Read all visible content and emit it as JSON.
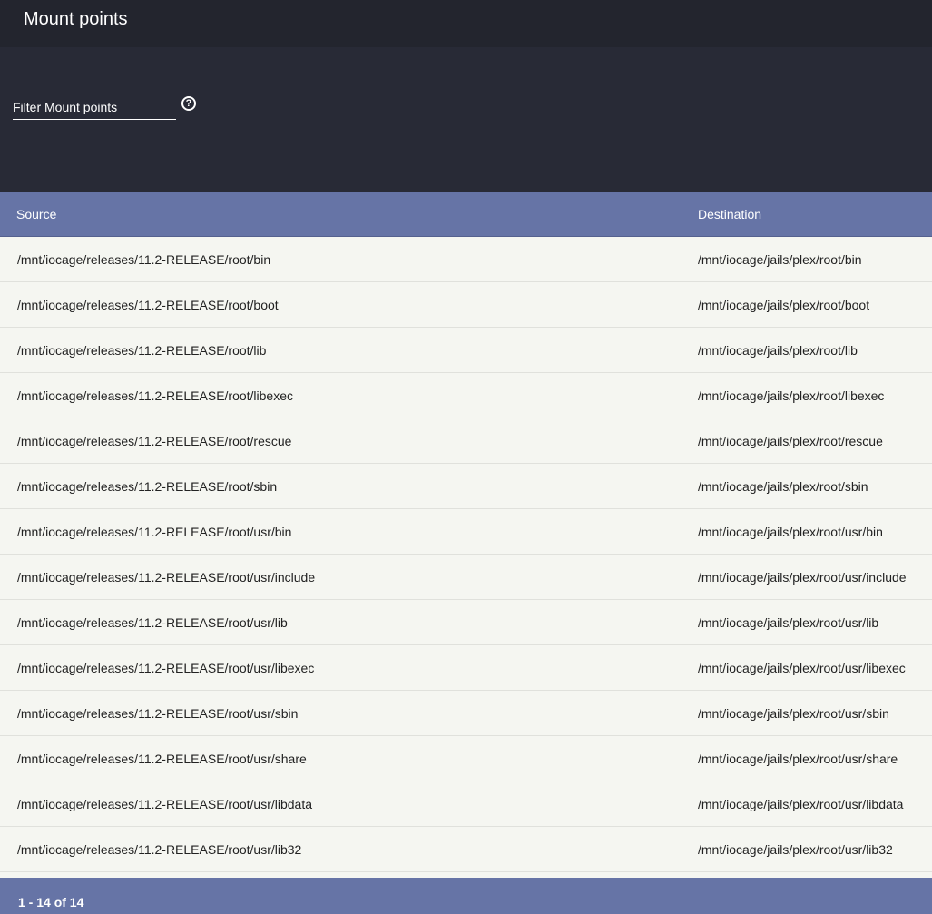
{
  "header": {
    "title": "Mount points"
  },
  "filter": {
    "placeholder": "Filter Mount points",
    "help_icon": "help-circle-icon"
  },
  "table": {
    "columns": [
      "Source",
      "Destination"
    ],
    "rows": [
      [
        "/mnt/iocage/releases/11.2-RELEASE/root/bin",
        "/mnt/iocage/jails/plex/root/bin"
      ],
      [
        "/mnt/iocage/releases/11.2-RELEASE/root/boot",
        "/mnt/iocage/jails/plex/root/boot"
      ],
      [
        "/mnt/iocage/releases/11.2-RELEASE/root/lib",
        "/mnt/iocage/jails/plex/root/lib"
      ],
      [
        "/mnt/iocage/releases/11.2-RELEASE/root/libexec",
        "/mnt/iocage/jails/plex/root/libexec"
      ],
      [
        "/mnt/iocage/releases/11.2-RELEASE/root/rescue",
        "/mnt/iocage/jails/plex/root/rescue"
      ],
      [
        "/mnt/iocage/releases/11.2-RELEASE/root/sbin",
        "/mnt/iocage/jails/plex/root/sbin"
      ],
      [
        "/mnt/iocage/releases/11.2-RELEASE/root/usr/bin",
        "/mnt/iocage/jails/plex/root/usr/bin"
      ],
      [
        "/mnt/iocage/releases/11.2-RELEASE/root/usr/include",
        "/mnt/iocage/jails/plex/root/usr/include"
      ],
      [
        "/mnt/iocage/releases/11.2-RELEASE/root/usr/lib",
        "/mnt/iocage/jails/plex/root/usr/lib"
      ],
      [
        "/mnt/iocage/releases/11.2-RELEASE/root/usr/libexec",
        "/mnt/iocage/jails/plex/root/usr/libexec"
      ],
      [
        "/mnt/iocage/releases/11.2-RELEASE/root/usr/sbin",
        "/mnt/iocage/jails/plex/root/usr/sbin"
      ],
      [
        "/mnt/iocage/releases/11.2-RELEASE/root/usr/share",
        "/mnt/iocage/jails/plex/root/usr/share"
      ],
      [
        "/mnt/iocage/releases/11.2-RELEASE/root/usr/libdata",
        "/mnt/iocage/jails/plex/root/usr/libdata"
      ],
      [
        "/mnt/iocage/releases/11.2-RELEASE/root/usr/lib32",
        "/mnt/iocage/jails/plex/root/usr/lib32"
      ]
    ]
  },
  "pagination": {
    "range": "1 - 14 of 14"
  }
}
